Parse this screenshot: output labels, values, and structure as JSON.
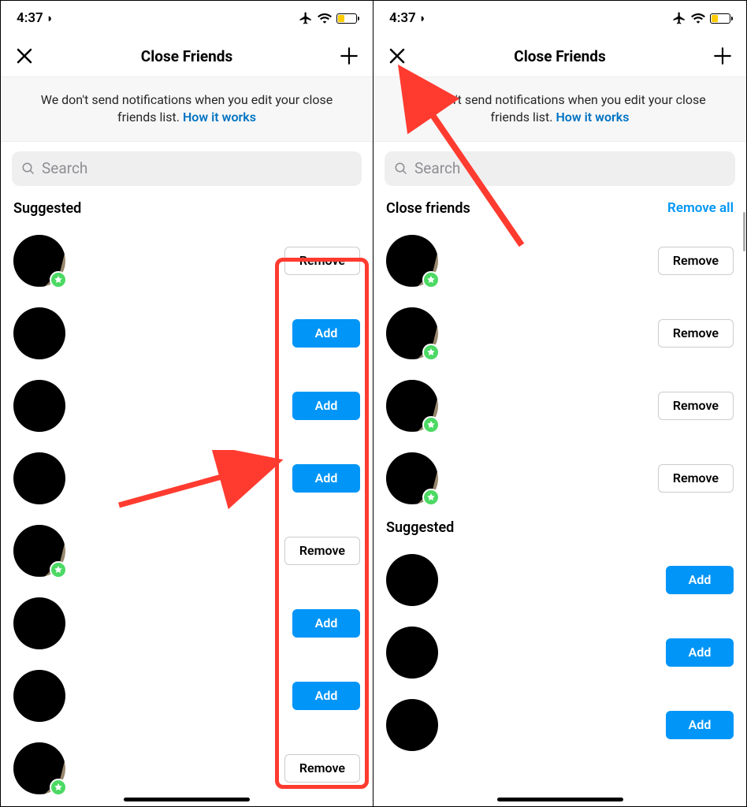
{
  "statusbar": {
    "time": "4:37"
  },
  "navbar": {
    "title": "Close Friends"
  },
  "banner": {
    "text": "We don't send notifications when you edit your close friends list. ",
    "link": "How it works"
  },
  "search": {
    "placeholder": "Search"
  },
  "left": {
    "sections": [
      {
        "title": "Suggested",
        "action": "",
        "rows": [
          {
            "badge": true,
            "btn": "Remove",
            "style": "remove",
            "bg": true
          },
          {
            "badge": false,
            "btn": "Add",
            "style": "add"
          },
          {
            "badge": false,
            "btn": "Add",
            "style": "add"
          },
          {
            "badge": false,
            "btn": "Add",
            "style": "add"
          },
          {
            "badge": true,
            "btn": "Remove",
            "style": "remove",
            "bg": true
          },
          {
            "badge": false,
            "btn": "Add",
            "style": "add"
          },
          {
            "badge": false,
            "btn": "Add",
            "style": "add"
          },
          {
            "badge": true,
            "btn": "Remove",
            "style": "remove",
            "bg": true
          }
        ]
      }
    ]
  },
  "right": {
    "sections": [
      {
        "title": "Close friends",
        "action": "Remove all",
        "rows": [
          {
            "badge": true,
            "btn": "Remove",
            "style": "remove",
            "bg": true
          },
          {
            "badge": true,
            "btn": "Remove",
            "style": "remove",
            "bg": true
          },
          {
            "badge": true,
            "btn": "Remove",
            "style": "remove",
            "bg": true
          },
          {
            "badge": true,
            "btn": "Remove",
            "style": "remove",
            "bg": true
          }
        ]
      },
      {
        "title": "Suggested",
        "action": "",
        "rows": [
          {
            "badge": false,
            "btn": "Add",
            "style": "add"
          },
          {
            "badge": false,
            "btn": "Add",
            "style": "add"
          },
          {
            "badge": false,
            "btn": "Add",
            "style": "add"
          }
        ]
      }
    ]
  }
}
